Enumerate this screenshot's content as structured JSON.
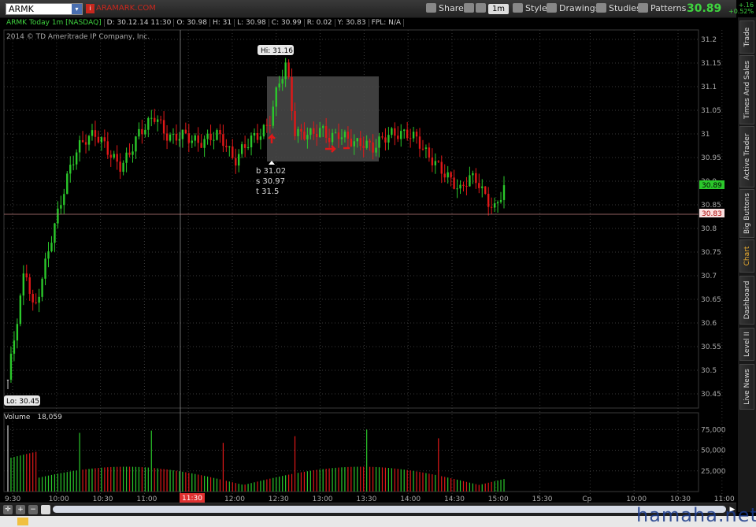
{
  "toolbar": {
    "symbol": "ARMK",
    "company": "ARAMARK.COM",
    "share_label": "Share",
    "timeframe_label": "1m",
    "style_label": "Style",
    "drawings_label": "Drawings",
    "studies_label": "Studies",
    "patterns_label": "Patterns",
    "last_price": "30.89",
    "change": "+.16",
    "change_pct": "+0.52%"
  },
  "chart_header": {
    "symbol": "ARMK Today 1m [NASDAQ]",
    "date": "D: 30.12.14 11:30",
    "open": "O: 30.98",
    "high": "H: 31",
    "low": "L: 30.98",
    "close": "C: 30.99",
    "range": "R: 0.02",
    "y": "Y: 30.83",
    "fpl": "FPL: N/A",
    "copyright": "2014 © TD Ameritrade IP Company, Inc."
  },
  "annotations": {
    "hi": "Hi: 31.16",
    "lo": "Lo: 30.45",
    "bid": "b 31.02",
    "ask": "s 30.97",
    "target": "t  31.5",
    "cursor_time": "11:30",
    "cursor_price": "30.83",
    "last_price_tag": "30.89"
  },
  "volume_header": {
    "label": "Volume",
    "value": "18,059"
  },
  "chart_data": {
    "type": "candlestick",
    "price_ticks": [
      "31.2",
      "31.15",
      "31.1",
      "31.05",
      "31",
      "30.95",
      "30.9",
      "30.85",
      "30.8",
      "30.75",
      "30.7",
      "30.65",
      "30.6",
      "30.55",
      "30.5",
      "30.45"
    ],
    "price_range": [
      30.42,
      31.22
    ],
    "volume_ticks": [
      "75,000",
      "50,000",
      "25,000"
    ],
    "volume_range": [
      0,
      80000
    ],
    "time_labels": [
      "9:30",
      "10:00",
      "10:30",
      "11:00",
      "11:30",
      "12:00",
      "12:30",
      "13:00",
      "13:30",
      "14:00",
      "14:30",
      "15:00",
      "15:30",
      "Cp",
      "10:00",
      "10:30",
      "11:00"
    ],
    "high": 31.16,
    "low": 30.45,
    "last": 30.89,
    "cursor_price": 30.83,
    "colors": {
      "up": "#2bc82b",
      "down": "#e01818",
      "neutral": "#cccccc",
      "grid": "#3a3a3a"
    }
  },
  "right_tabs": [
    "Trade",
    "Times And Sales",
    "Active Trader",
    "Big Buttons",
    "Chart",
    "Dashboard",
    "Level II",
    "Live News"
  ],
  "watermark": "hamaha.net"
}
